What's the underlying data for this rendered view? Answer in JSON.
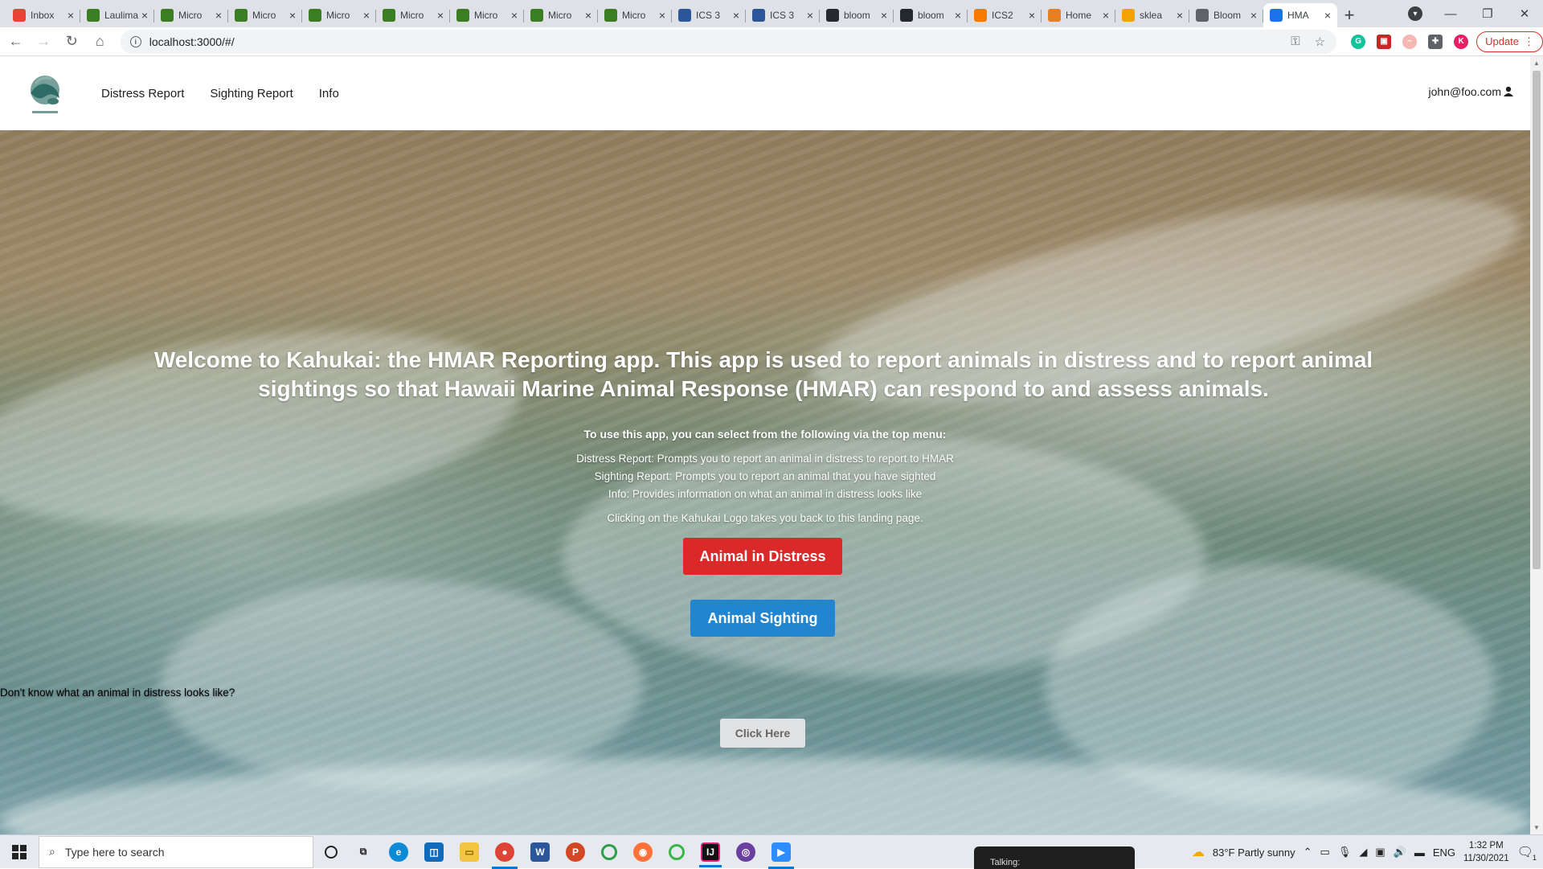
{
  "browser": {
    "tabs": [
      {
        "title": "Inbox",
        "icon": "gmail-icon",
        "color": "#ea4335"
      },
      {
        "title": "Laulima",
        "icon": "laulima-icon",
        "color": "#3a7d23"
      },
      {
        "title": "Micro",
        "icon": "laulima-icon",
        "color": "#3a7d23"
      },
      {
        "title": "Micro",
        "icon": "laulima-icon",
        "color": "#3a7d23"
      },
      {
        "title": "Micro",
        "icon": "laulima-icon",
        "color": "#3a7d23"
      },
      {
        "title": "Micro",
        "icon": "laulima-icon",
        "color": "#3a7d23"
      },
      {
        "title": "Micro",
        "icon": "laulima-icon",
        "color": "#3a7d23"
      },
      {
        "title": "Micro",
        "icon": "laulima-icon",
        "color": "#3a7d23"
      },
      {
        "title": "Micro",
        "icon": "laulima-icon",
        "color": "#3a7d23"
      },
      {
        "title": "ICS 3",
        "icon": "doc-icon",
        "color": "#2b579a"
      },
      {
        "title": "ICS 3",
        "icon": "doc-icon",
        "color": "#2b579a"
      },
      {
        "title": "bloom",
        "icon": "github-icon",
        "color": "#24292e"
      },
      {
        "title": "bloom",
        "icon": "github-icon",
        "color": "#24292e"
      },
      {
        "title": "ICS2",
        "icon": "loading-icon",
        "color": "#f57c00"
      },
      {
        "title": "Home",
        "icon": "home-icon",
        "color": "#e67e22"
      },
      {
        "title": "sklea",
        "icon": "chart-icon",
        "color": "#f4a300"
      },
      {
        "title": "Bloom",
        "icon": "globe-icon",
        "color": "#5f6368"
      },
      {
        "title": "HMA",
        "icon": "page-icon",
        "color": "#1a73e8"
      }
    ],
    "url": "localhost:3000/#/",
    "update_label": "Update"
  },
  "nav": {
    "links": [
      "Distress Report",
      "Sighting Report",
      "Info"
    ],
    "user": "john@foo.com"
  },
  "hero": {
    "title": "Welcome to Kahukai: the HMAR Reporting app. This app is used to report animals in distress and to report animal sightings so that Hawaii Marine Animal Response (HMAR) can respond to and assess animals.",
    "intro": "To use this app, you can select from the following via the top menu:",
    "lines": [
      "Distress Report: Prompts you to report an animal in distress to report to HMAR",
      "Sighting Report: Prompts you to report an animal that you have sighted",
      "Info: Provides information on what an animal in distress looks like"
    ],
    "logo_note": "Clicking on the Kahukai Logo takes you back to this landing page.",
    "distress_button": "Animal in Distress",
    "sighting_button": "Animal Sighting",
    "question": "Don't know what an animal in distress looks like?",
    "click_here": "Click Here"
  },
  "taskbar": {
    "search_placeholder": "Type here to search",
    "talking": "Talking:",
    "weather": "83°F  Partly sunny",
    "lang": "ENG",
    "time": "1:32 PM",
    "date": "11/30/2021",
    "notif_count": "1"
  }
}
